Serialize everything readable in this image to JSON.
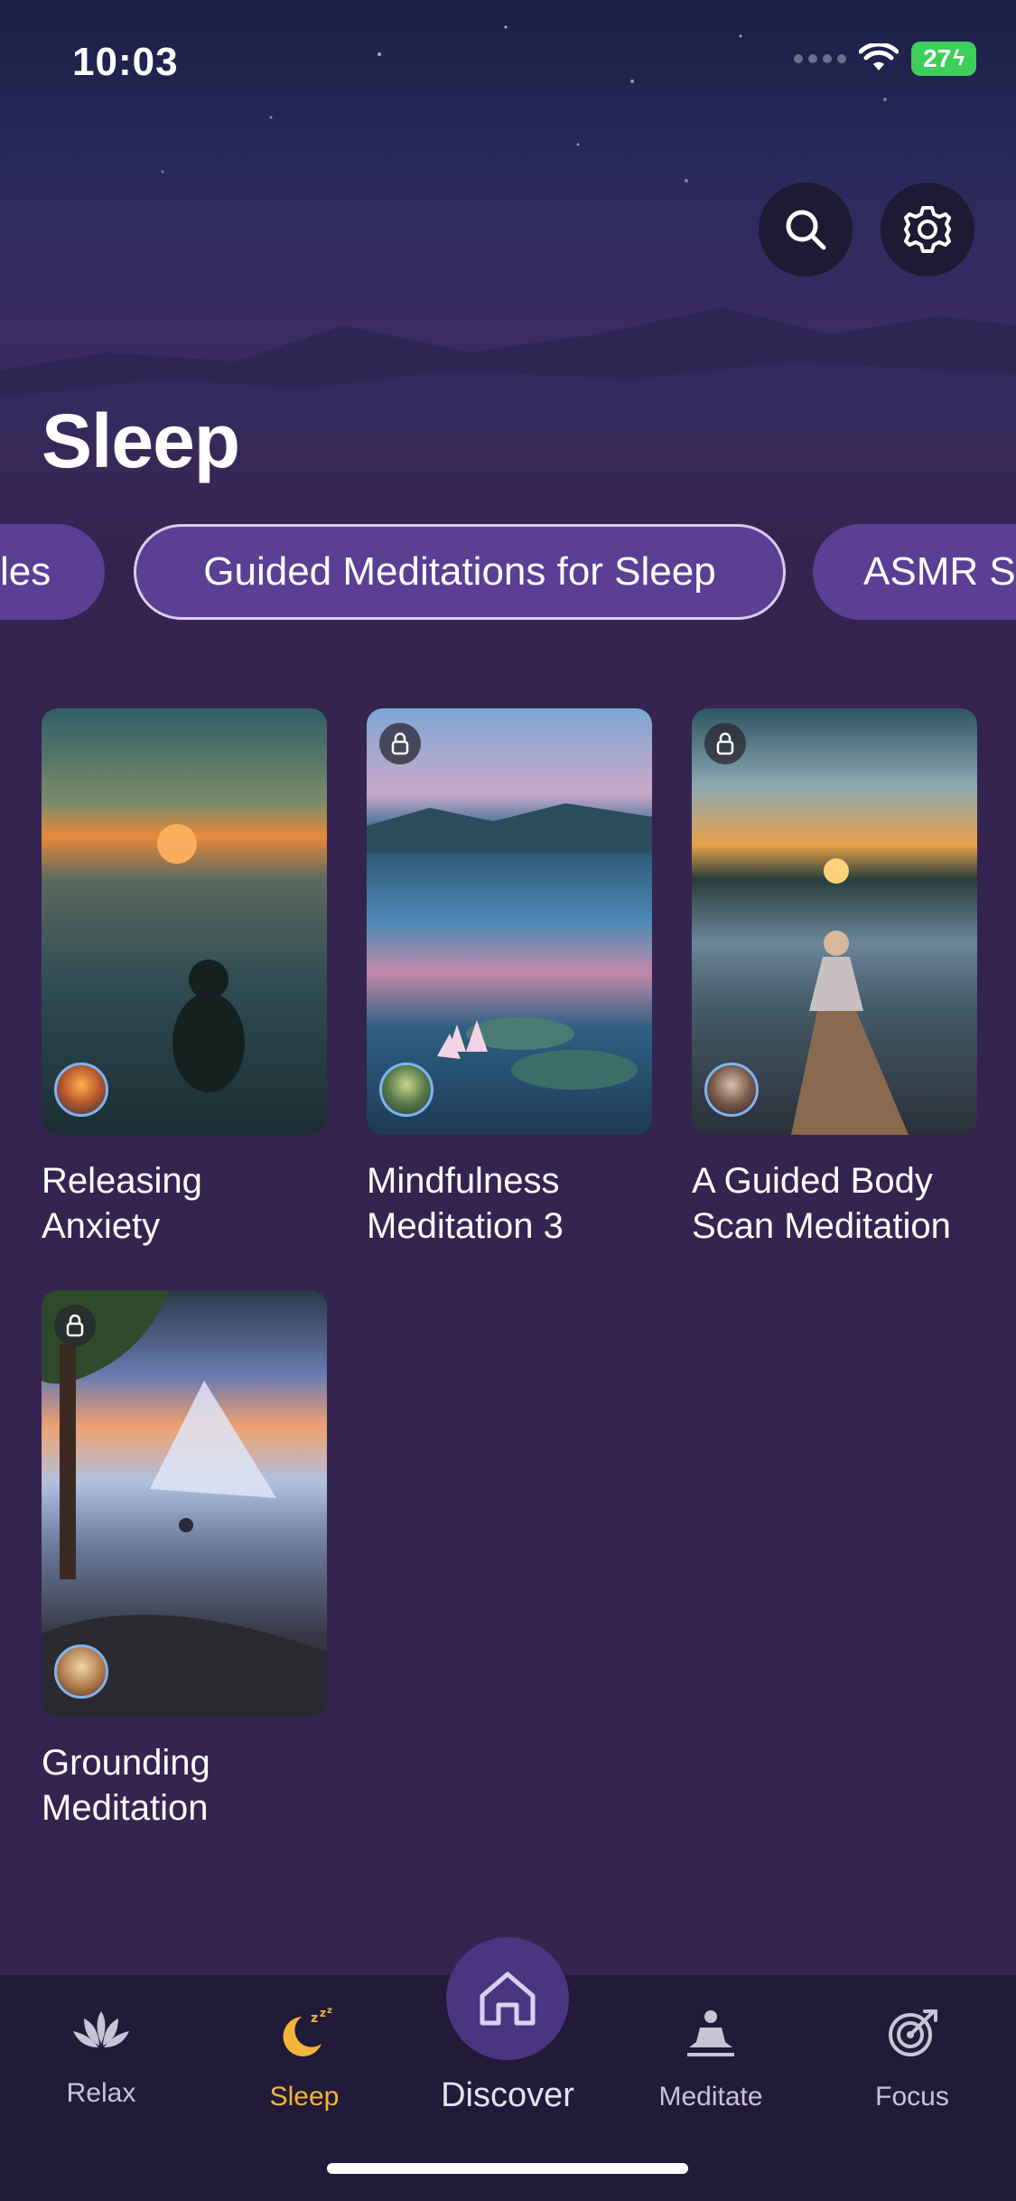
{
  "status_bar": {
    "time": "10:03",
    "battery": "27"
  },
  "page": {
    "title": "Sleep"
  },
  "categories": {
    "items": [
      {
        "label": "les"
      },
      {
        "label": "Guided Meditations for Sleep",
        "selected": true
      },
      {
        "label": "ASMR S"
      }
    ]
  },
  "cards": [
    {
      "title_line1": "Releasing",
      "title_line2": "Anxiety",
      "locked": false
    },
    {
      "title_line1": "Mindfulness",
      "title_line2": "Meditation 3",
      "locked": true
    },
    {
      "title_line1": "A Guided Body",
      "title_line2": "Scan Meditation",
      "locked": true
    },
    {
      "title_line1": "Grounding",
      "title_line2": "Meditation",
      "locked": true
    }
  ],
  "tabbar": {
    "relax": "Relax",
    "sleep": "Sleep",
    "discover": "Discover",
    "meditate": "Meditate",
    "focus": "Focus",
    "active": "Sleep"
  },
  "colors": {
    "background": "#34244f",
    "chip": "#5a3f94",
    "active_tab": "#f3b53a",
    "tabbar": "#211a38"
  },
  "icons": {
    "search": "search-icon",
    "settings": "gear-icon",
    "lock": "lock-icon",
    "relax": "lotus-icon",
    "sleep": "moon-zzz-icon",
    "discover": "home-icon",
    "meditate": "meditating-person-icon",
    "focus": "target-icon"
  }
}
